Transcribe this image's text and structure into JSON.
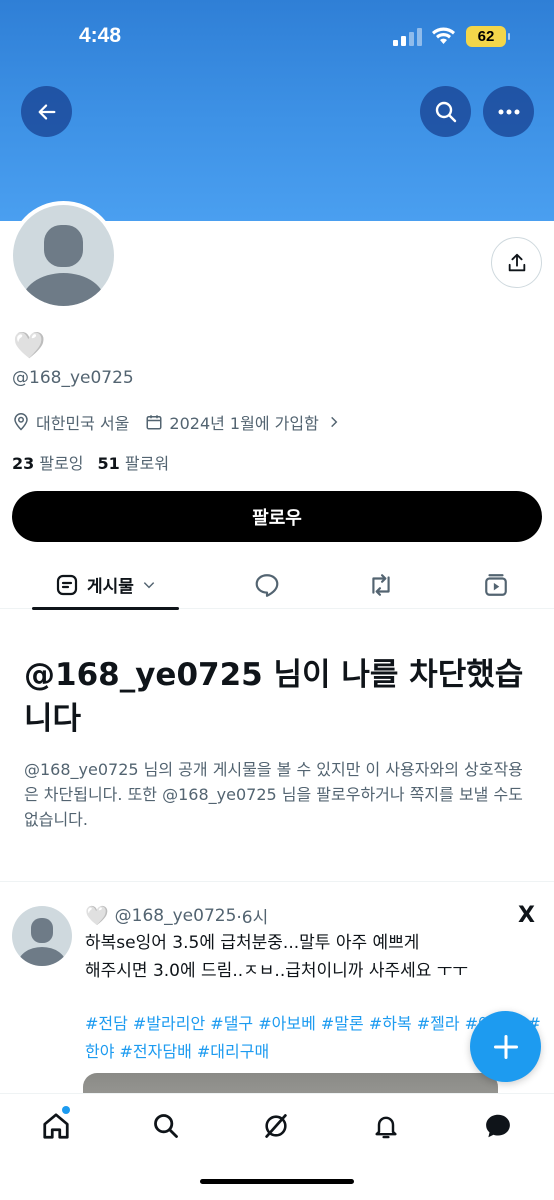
{
  "status_bar": {
    "time": "4:48",
    "battery": "62"
  },
  "profile": {
    "heart": "🤍",
    "handle": "@168_ye0725",
    "location": "대한민국 서울",
    "joined": "2024년 1월에 가입함",
    "following_count": "23",
    "following_label": "팔로잉",
    "followers_count": "51",
    "followers_label": "팔로워",
    "follow_button": "팔로우"
  },
  "tabs": {
    "posts_label": "게시물"
  },
  "blocked": {
    "title": "@168_ye0725 님이 나를 차단했습니다",
    "body": "@168_ye0725 님의 공개 게시물을 볼 수 있지만 이 사용자와의 상호작용은 차단됩니다. 또한 @168_ye0725 님을 팔로우하거나 쪽지를 보낼 수도 없습니다."
  },
  "tweet": {
    "heart": "🤍",
    "handle": "@168_ye0725",
    "time": "·6시",
    "source_logo": "X",
    "text": "하복se잉어 3.5에 급처분중...말투 아주 예쁘게\n해주시면 3.0에 드림..ㅈㅂ..급처이니까 사주세요 ㅜㅜ",
    "tags": "#전담 #발라리안 #댈구 #아보베 #말론 #하복 #젤라 #아스몬 #한야 #전자담배 #대리구매"
  },
  "colors": {
    "accent": "#1d9bf0",
    "banner": "#3e92e6",
    "text": "#0f1419",
    "muted": "#536471"
  },
  "icons": [
    "back-arrow-icon",
    "search-icon",
    "more-icon",
    "share-icon",
    "location-icon",
    "calendar-icon",
    "chevron-right-icon",
    "posts-icon",
    "chevron-down-icon",
    "reply-icon",
    "repost-icon",
    "media-icon",
    "compose-plus-icon",
    "home-icon",
    "search-nav-icon",
    "grok-icon",
    "bell-icon",
    "messages-icon"
  ]
}
